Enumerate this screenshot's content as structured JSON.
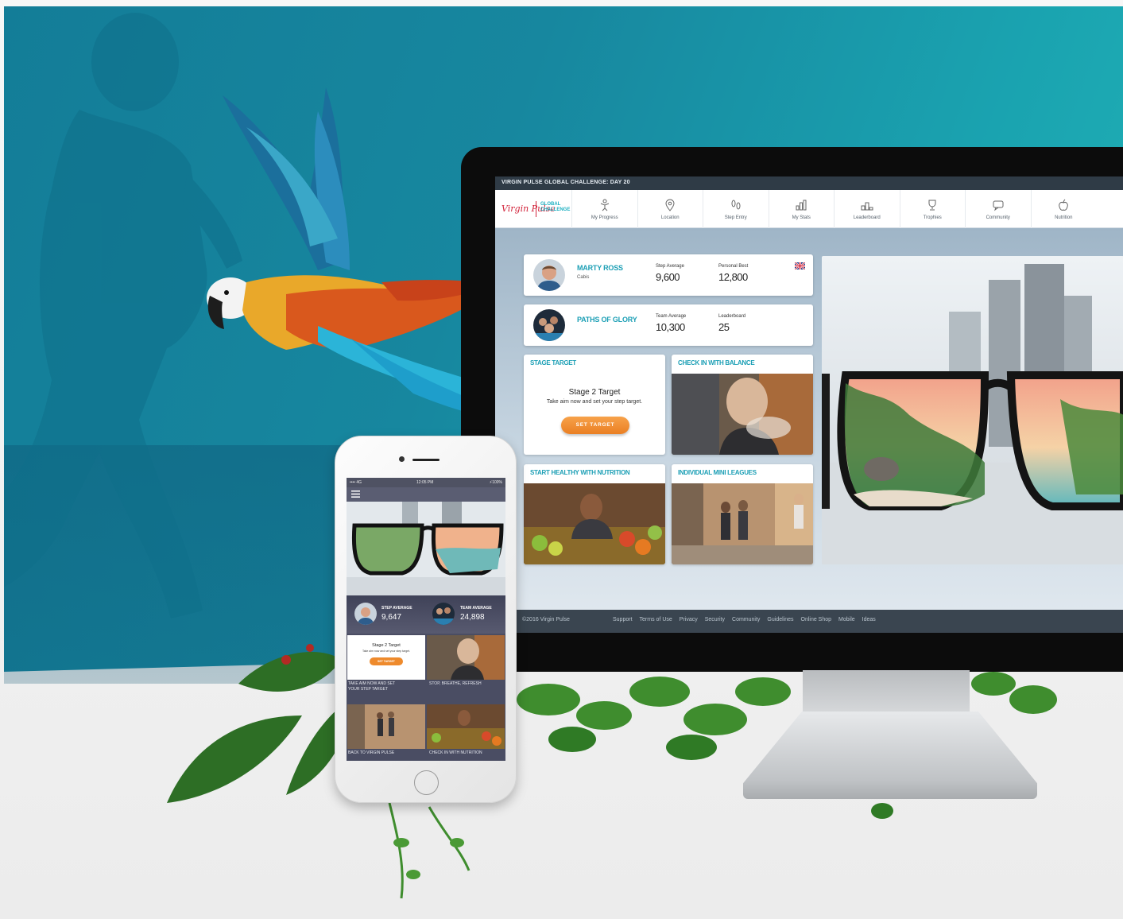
{
  "colors": {
    "teal_bg": "#17879f",
    "accent_teal": "#1c9fb5",
    "orange_button": "#ea7f23",
    "topbar": "#2f3b46",
    "footer": "#3a4550",
    "brand_red": "#d2243b"
  },
  "desktop": {
    "topbar_title": "VIRGIN PULSE GLOBAL CHALLENGE: DAY 20",
    "logo": {
      "brand": "Virgin Pulse",
      "product_line1": "GLOBAL",
      "product_line2": "CHALLENGE"
    },
    "nav": [
      {
        "label": "My Progress",
        "icon": "trophy-figure-icon"
      },
      {
        "label": "Location",
        "icon": "map-pin-icon"
      },
      {
        "label": "Step Entry",
        "icon": "footsteps-icon"
      },
      {
        "label": "My Stats",
        "icon": "bar-chart-icon"
      },
      {
        "label": "Leaderboard",
        "icon": "podium-icon"
      },
      {
        "label": "Trophies",
        "icon": "trophy-icon"
      },
      {
        "label": "Community",
        "icon": "chat-bubble-icon"
      },
      {
        "label": "Nutrition",
        "icon": "apple-icon"
      }
    ],
    "profile": {
      "name": "MARTY ROSS",
      "sub": "Cabis",
      "stat1_label": "Step Average",
      "stat1_value": "9,600",
      "stat2_label": "Personal Best",
      "stat2_value": "12,800"
    },
    "team": {
      "name": "PATHS OF GLORY",
      "stat1_label": "Team Average",
      "stat1_value": "10,300",
      "stat2_label": "Leaderboard",
      "stat2_value": "25"
    },
    "tiles": {
      "stage_target": {
        "title": "STAGE TARGET",
        "heading": "Stage 2 Target",
        "sub": "Take aim now and set your step target.",
        "button": "SET TARGET"
      },
      "balance": {
        "title": "CHECK IN WITH BALANCE"
      },
      "nutrition": {
        "title": "START HEALTHY WITH NUTRITION"
      },
      "leagues": {
        "title": "INDIVIDUAL MINI LEAGUES"
      }
    },
    "footer": {
      "copyright": "©2016 Virgin Pulse",
      "links": [
        "Support",
        "Terms of Use",
        "Privacy",
        "Security",
        "Community",
        "Guidelines",
        "Online Shop",
        "Mobile",
        "Ideas"
      ]
    }
  },
  "phone": {
    "status_left": "•••• 4G",
    "status_time": "12:05 PM",
    "status_right": "⚡100%",
    "step_label": "STEP AVERAGE",
    "step_value": "9,647",
    "team_label": "TEAM AVERAGE",
    "team_value": "24,898",
    "target_heading": "Stage 2 Target",
    "target_sub": "Take aim now and set your step target.",
    "target_button": "SET TARGET",
    "captions": {
      "c1_line1": "TAKE AIM NOW AND SET",
      "c1_line2": "YOUR STEP TARGET",
      "c2": "STOP, BREATHE, REFRESH",
      "c3": "BACK TO VIRGIN PULSE",
      "c4": "CHECK IN WITH NUTRITION"
    }
  }
}
